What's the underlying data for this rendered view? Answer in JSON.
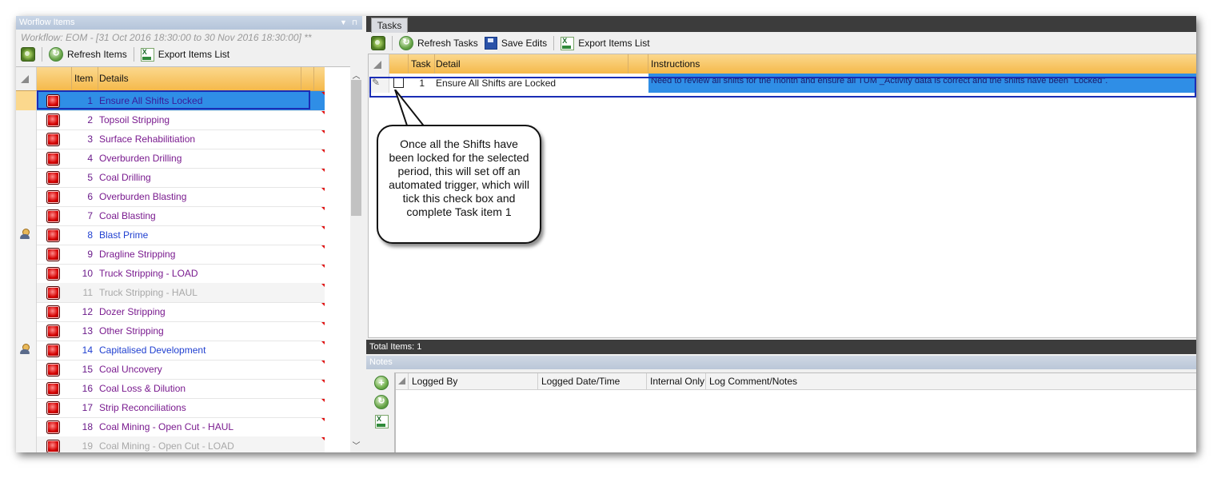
{
  "left_panel": {
    "title": "Worflow Items",
    "pin_glyph": "▾ ⊓",
    "workflow": "Workflow: EOM - [31 Oct 2016 18:30:00 to 30 Nov 2016 18:30:00] **",
    "toolbar": {
      "refresh_label": "Refresh Items",
      "export_label": "Export Items List"
    },
    "columns": {
      "item": "Item",
      "details": "Details"
    },
    "rows": [
      {
        "item": "1",
        "details": "Ensure All Shifts Locked",
        "style": "sel",
        "user": false
      },
      {
        "item": "2",
        "details": "Topsoil Stripping",
        "style": "normal",
        "user": false
      },
      {
        "item": "3",
        "details": "Surface Rehabilitiation",
        "style": "normal",
        "user": false
      },
      {
        "item": "4",
        "details": "Overburden Drilling",
        "style": "normal",
        "user": false
      },
      {
        "item": "5",
        "details": "Coal Drilling",
        "style": "normal",
        "user": false
      },
      {
        "item": "6",
        "details": "Overburden Blasting",
        "style": "normal",
        "user": false
      },
      {
        "item": "7",
        "details": "Coal Blasting",
        "style": "normal",
        "user": false
      },
      {
        "item": "8",
        "details": "Blast Prime",
        "style": "blue",
        "user": true
      },
      {
        "item": "9",
        "details": "Dragline Stripping",
        "style": "normal",
        "user": false
      },
      {
        "item": "10",
        "details": "Truck Stripping - LOAD",
        "style": "normal",
        "user": false
      },
      {
        "item": "11",
        "details": "Truck Stripping - HAUL",
        "style": "grey",
        "user": false
      },
      {
        "item": "12",
        "details": "Dozer Stripping",
        "style": "normal",
        "user": false
      },
      {
        "item": "13",
        "details": "Other Stripping",
        "style": "normal",
        "user": false
      },
      {
        "item": "14",
        "details": "Capitalised Development",
        "style": "blue",
        "user": true
      },
      {
        "item": "15",
        "details": "Coal Uncovery",
        "style": "normal",
        "user": false
      },
      {
        "item": "16",
        "details": "Coal Loss & Dilution",
        "style": "normal",
        "user": false
      },
      {
        "item": "17",
        "details": "Strip Reconciliations",
        "style": "normal",
        "user": false
      },
      {
        "item": "18",
        "details": "Coal Mining - Open Cut - HAUL",
        "style": "normal",
        "user": false
      },
      {
        "item": "19",
        "details": "Coal Mining - Open Cut - LOAD",
        "style": "grey",
        "user": false
      }
    ]
  },
  "right_panel": {
    "tab": "Tasks",
    "toolbar": {
      "refresh_label": "Refresh Tasks",
      "save_label": "Save Edits",
      "export_label": "Export Items List"
    },
    "columns": {
      "task": "Task",
      "detail": "Detail",
      "instructions": "Instructions"
    },
    "task_row": {
      "task": "1",
      "detail": "Ensure All Shifts are Locked",
      "instructions": "Need to review all shifts for the month and ensure all TUM _Activity data is correct and the shifts have been \"Locked\".",
      "checked": false
    },
    "total": "Total Items: 1",
    "notes": {
      "title": "Notes",
      "columns": {
        "logged_by": "Logged By",
        "logged_dt": "Logged Date/Time",
        "internal": "Internal Only",
        "comment": "Log Comment/Notes"
      }
    }
  },
  "callout": {
    "text": "Once all the Shifts have been locked for the selected period, this will set off an automated trigger, which will tick this check box and complete Task item 1"
  },
  "colors": {
    "header_orange": "#f5b94b",
    "selection_blue": "#2f8ee6",
    "highlight_border": "#1a2db5",
    "item_purple": "#7a1b8f",
    "item_blue": "#1f3fd0",
    "status_red": "#d40000"
  },
  "icons": {
    "equipment": "equipment-gear-icon",
    "refresh": "refresh-icon",
    "excel": "excel-export-icon",
    "save": "save-disk-icon",
    "status": "red-status-light-icon",
    "user": "user-icon",
    "add": "add-note-icon"
  }
}
